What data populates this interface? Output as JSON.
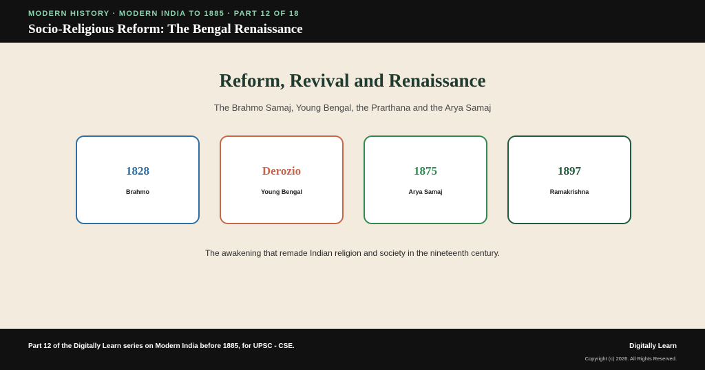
{
  "header": {
    "eyebrow": "MODERN HISTORY · MODERN INDIA TO 1885 · PART 12 OF 18",
    "title": "Socio-Religious Reform: The Bengal Renaissance"
  },
  "main": {
    "heading": "Reform, Revival and Renaissance",
    "subheading": "The Brahmo Samaj, Young Bengal, the Prarthana and the Arya Samaj",
    "cards": [
      {
        "value": "1828",
        "label": "Brahmo",
        "color": "#2e6fa3"
      },
      {
        "value": "Derozio",
        "label": "Young Bengal",
        "color": "#c8664a"
      },
      {
        "value": "1875",
        "label": "Arya Samaj",
        "color": "#2e8a4e"
      },
      {
        "value": "1897",
        "label": "Ramakrishna",
        "color": "#1f5a3c"
      }
    ],
    "tagline": "The awakening that remade Indian religion and society in the nineteenth century."
  },
  "footer": {
    "series": "Part 12 of the Digitally Learn series on Modern India before 1885, for UPSC - CSE.",
    "brand": "Digitally Learn",
    "copyright": "Copyright (c) 2026. All Rights Reserved."
  },
  "colors": {
    "background": "#f4ebdf",
    "bar": "#111111",
    "eyebrow": "#8fd3b0",
    "heading": "#1f3a2e"
  }
}
